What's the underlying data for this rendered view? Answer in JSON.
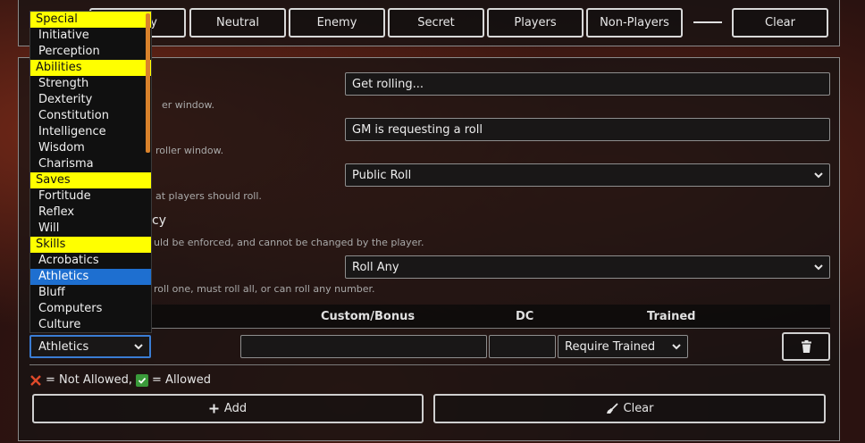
{
  "filter_bar": {
    "partial_label": "ly",
    "buttons": [
      "Neutral",
      "Enemy",
      "Secret",
      "Players",
      "Non-Players"
    ],
    "clear_label": "Clear"
  },
  "form": {
    "title_value": "Get rolling...",
    "title_hint_partial": "er window.",
    "flavor_value": "GM is requesting a roll",
    "flavor_hint_partial": "roller window.",
    "roll_mode_value": "Public Roll",
    "roll_mode_hint_partial": "at players should roll.",
    "privacy_label_partial": "cy",
    "privacy_hint_partial": "uld be enforced, and cannot be changed by the player.",
    "roll_type_value": "Roll Any",
    "roll_type_hint_partial": "roll one, must roll all, or can roll any number."
  },
  "table": {
    "headers": [
      "Custom/Bonus",
      "DC",
      "Trained"
    ],
    "row": {
      "skill": "Athletics",
      "custom_bonus": "",
      "dc": "",
      "trained": "Require Trained"
    }
  },
  "legend": {
    "not_allowed": "= Not Allowed,",
    "allowed": "= Allowed"
  },
  "actions": {
    "add_label": "Add",
    "clear_label": "Clear"
  },
  "dropdown": {
    "items": [
      {
        "label": "Special",
        "group": true
      },
      {
        "label": "Initiative"
      },
      {
        "label": "Perception"
      },
      {
        "label": "Abilities",
        "group": true
      },
      {
        "label": "Strength"
      },
      {
        "label": "Dexterity"
      },
      {
        "label": "Constitution"
      },
      {
        "label": "Intelligence"
      },
      {
        "label": "Wisdom"
      },
      {
        "label": "Charisma"
      },
      {
        "label": "Saves",
        "group": true
      },
      {
        "label": "Fortitude"
      },
      {
        "label": "Reflex"
      },
      {
        "label": "Will"
      },
      {
        "label": "Skills",
        "group": true
      },
      {
        "label": "Acrobatics"
      },
      {
        "label": "Athletics",
        "selected": true
      },
      {
        "label": "Bluff"
      },
      {
        "label": "Computers"
      },
      {
        "label": "Culture"
      }
    ]
  },
  "colors": {
    "group_highlight": "#ffff00",
    "selected_highlight": "#1e6fd0",
    "scrollbar": "#d9822b",
    "not_allowed_icon": "#e04a2a",
    "allowed_icon": "#3a9a3a"
  }
}
